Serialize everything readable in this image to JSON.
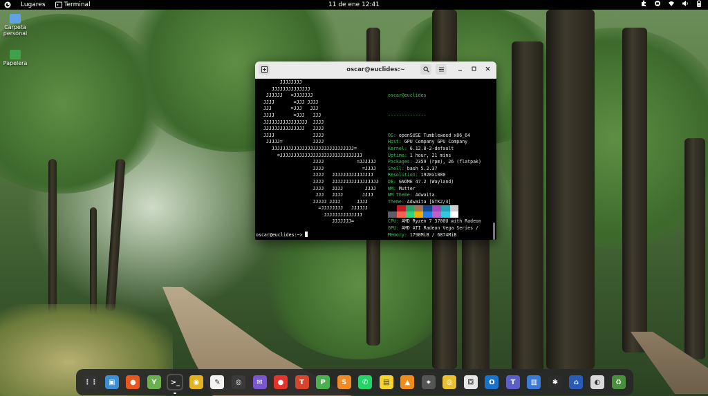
{
  "topbar": {
    "activities_icon": "gnome-activities-icon",
    "places": "Lugares",
    "app_name": "Terminal",
    "clock": "11 de ene  12:41",
    "tray": [
      "extensions-icon",
      "network-icon",
      "wifi-icon",
      "speaker-icon",
      "battery-icon"
    ]
  },
  "desktop": {
    "icons": [
      {
        "label": "Carpeta personal",
        "icon": "home-folder-icon"
      },
      {
        "label": "Papelera",
        "icon": "trash-icon"
      }
    ]
  },
  "terminal": {
    "title": "oscar@euclides:~",
    "ascii_art": [
      "       JJJJJJJJ",
      "    JJJJJJJJJJJJJJ",
      "  JJJJJJ   =JJJJJJJ",
      " JJJJ       =JJJ JJJJ",
      " JJJ       =JJJ   JJJ",
      " JJJJ       =JJJ   JJJ",
      " JJJJJJJJJJJJJJJJ  JJJJ",
      " JJJJJJJJJJJJJJJ   JJJJ",
      " JJJJ              JJJJ",
      "  JJJJJ=           JJJJ",
      "    JJJJJJJJJJJJJJJJJJJJJJJJJJJJJJ=",
      "      =JJJJJJJJJJJJJJJJJJJJJJJJJJJJJJ",
      "                   JJJJ            =JJJJJJ",
      "                   JJJJ              =JJJJ",
      "                   JJJJ   JJJJJJJJJJJJJJJ",
      "                   JJJJ   JJJJJJJJJJJJJJJJJ",
      "                   JJJJ   JJJJ        JJJJ",
      "                    JJJ   JJJJ       JJJJ",
      "                   JJJJJ JJJJ      JJJJ",
      "                     =JJJJJJJJ   JJJJJJ",
      "                       JJJJJJJJJJJJJJ",
      "                          JJJJJJJ="
    ],
    "user_host": "oscar@euclides",
    "separator": "--------------",
    "info": [
      {
        "key": "OS",
        "value": "openSUSE Tumbleweed x86_64"
      },
      {
        "key": "Host",
        "value": "GPU Company GPU Company"
      },
      {
        "key": "Kernel",
        "value": "6.12.8-2-default"
      },
      {
        "key": "Uptime",
        "value": "1 hour, 21 mins"
      },
      {
        "key": "Packages",
        "value": "2359 (rpm), 26 (flatpak)"
      },
      {
        "key": "Shell",
        "value": "bash 5.2.37"
      },
      {
        "key": "Resolution",
        "value": "1920x1080"
      },
      {
        "key": "DE",
        "value": "GNOME 47.2 (Wayland)"
      },
      {
        "key": "WM",
        "value": "Mutter"
      },
      {
        "key": "WM Theme",
        "value": "Adwaita"
      },
      {
        "key": "Theme",
        "value": "Adwaita [GTK2/3]"
      },
      {
        "key": "Icons",
        "value": "Adwaita [GTK2/3]"
      },
      {
        "key": "Terminal",
        "value": "gnome-terminal"
      },
      {
        "key": "CPU",
        "value": "AMD Ryzen 7 3700U with Radeon"
      },
      {
        "key": "GPU",
        "value": "AMD ATI Radeon Vega Series /"
      },
      {
        "key": "Memory",
        "value": "1790MiB / 6874MiB"
      }
    ],
    "palette_row1": [
      "#000000",
      "#c01c28",
      "#26a269",
      "#a2734c",
      "#12488b",
      "#a347ba",
      "#2aa1b3",
      "#d0cfcc"
    ],
    "palette_row2": [
      "#5e5c64",
      "#f66151",
      "#33d17a",
      "#e9ad0c",
      "#2a7bde",
      "#c061cb",
      "#33c7de",
      "#ffffff"
    ],
    "prompt": "oscar@euclides:~>"
  },
  "dock": [
    {
      "name": "app-grid-icon",
      "color": "#333333",
      "glyph": "⋮⋮"
    },
    {
      "name": "desktop-folder-icon",
      "color": "#3d8fd1",
      "glyph": "▣"
    },
    {
      "name": "firefox-icon",
      "color": "#e8581e",
      "glyph": "●"
    },
    {
      "name": "yast-icon",
      "color": "#6ab04c",
      "glyph": "Y"
    },
    {
      "name": "terminal-icon",
      "color": "#2b2b2b",
      "glyph": ">_",
      "active": true
    },
    {
      "name": "chrome-icon",
      "color": "#e3b321",
      "glyph": "◉"
    },
    {
      "name": "text-editor-icon",
      "color": "#f2f2f2",
      "glyph": "✎"
    },
    {
      "name": "obs-icon",
      "color": "#3a3a3a",
      "glyph": "◎"
    },
    {
      "name": "mail-icon",
      "color": "#7a57d1",
      "glyph": "✉"
    },
    {
      "name": "recorder-icon",
      "color": "#e5352b",
      "glyph": "●"
    },
    {
      "name": "wps-writer-icon",
      "color": "#d6452c",
      "glyph": "T"
    },
    {
      "name": "wps-presentation-icon",
      "color": "#4caf50",
      "glyph": "P"
    },
    {
      "name": "wps-spreadsheet-icon",
      "color": "#f08a24",
      "glyph": "S"
    },
    {
      "name": "whatsapp-icon",
      "color": "#25d366",
      "glyph": "✆"
    },
    {
      "name": "sticky-notes-icon",
      "color": "#f6d32d",
      "glyph": "▤"
    },
    {
      "name": "vlc-icon",
      "color": "#f28c18",
      "glyph": "▲"
    },
    {
      "name": "screenshot-icon",
      "color": "#555555",
      "glyph": "⌖"
    },
    {
      "name": "disc-icon",
      "color": "#e9c130",
      "glyph": "◎"
    },
    {
      "name": "software-store-icon",
      "color": "#e6e6e6",
      "glyph": "⛋"
    },
    {
      "name": "outlook-icon",
      "color": "#1a73c8",
      "glyph": "O"
    },
    {
      "name": "teams-icon",
      "color": "#5b5fc7",
      "glyph": "T"
    },
    {
      "name": "document-viewer-icon",
      "color": "#3b7bd6",
      "glyph": "▥"
    },
    {
      "name": "inkscape-icon",
      "color": "#2c2c2c",
      "glyph": "✱"
    },
    {
      "name": "scanner-icon",
      "color": "#2b5bb8",
      "glyph": "⌂"
    },
    {
      "name": "disc-burner-icon",
      "color": "#d9d9d9",
      "glyph": "◐"
    },
    {
      "name": "trash-icon",
      "color": "#4a8f3c",
      "glyph": "♻"
    }
  ]
}
